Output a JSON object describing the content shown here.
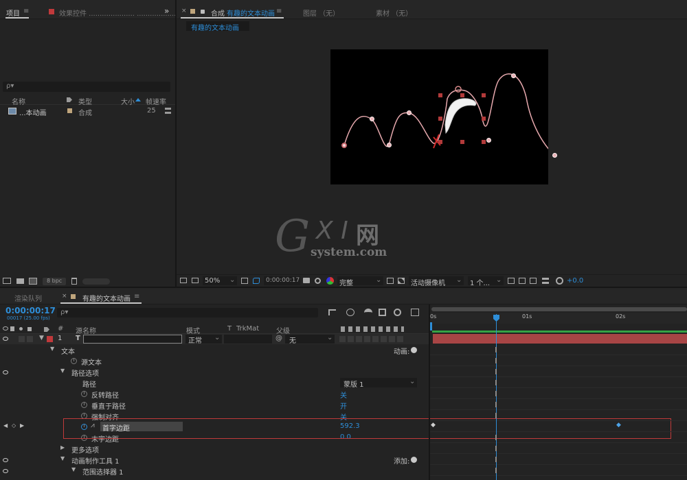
{
  "project_panel": {
    "tab_project": "项目",
    "tab_effects": "效果控件 ..................... ......................",
    "search_placeholder": "ρ▾",
    "columns": {
      "name": "名称",
      "type": "类型",
      "size": "大小",
      "fps": "帧速率"
    },
    "item": {
      "name": "...本动画",
      "type": "合成",
      "fps": "25"
    },
    "bpc": "8 bpc"
  },
  "composition_panel": {
    "tab_prefix": "合成",
    "comp_name": "有趣的文本动画",
    "tab_layer": "图层 （无）",
    "tab_footage": "素材 （无）",
    "breadcrumb": "有趣的文本动画",
    "toolbar": {
      "zoom": "50%",
      "timecode": "0:00:00:17",
      "resolution": "完整",
      "camera": "活动摄像机",
      "views": "1 个...",
      "exposure": "+0.0"
    }
  },
  "watermark": {
    "brand_g": "G",
    "brand_xi": "X I",
    "brand_cn": "网",
    "domain": "system.com"
  },
  "timeline": {
    "tab_render": "渲染队列",
    "comp_name": "有趣的文本动画",
    "timecode": "0:00:00:17",
    "frame_info": "00017 (25.00 fps)",
    "search_placeholder": "ρ▾",
    "headers": {
      "num": "#",
      "source": "源名称",
      "mode": "模式",
      "t": "T",
      "trkmat": "TrkMat",
      "parent": "父级"
    },
    "layer": {
      "num": "1",
      "mode": "正常",
      "parent": "无"
    },
    "ruler": [
      "0s",
      "01s",
      "02s"
    ],
    "tree": [
      {
        "label": "文本",
        "right": "动画:"
      },
      {
        "label": "源文本"
      },
      {
        "label": "路径选项"
      },
      {
        "label": "路径",
        "value": "蒙版 1"
      },
      {
        "label": "反转路径",
        "value": "关"
      },
      {
        "label": "垂直于路径",
        "value": "开"
      },
      {
        "label": "强制对齐",
        "value": "关"
      },
      {
        "label": "首字边距",
        "value": "592.3"
      },
      {
        "label": "末字边距",
        "value": "0.0"
      },
      {
        "label": "更多选项"
      },
      {
        "label": "动画制作工具 1",
        "right": "添加:"
      },
      {
        "label": "范围选择器 1"
      }
    ]
  }
}
